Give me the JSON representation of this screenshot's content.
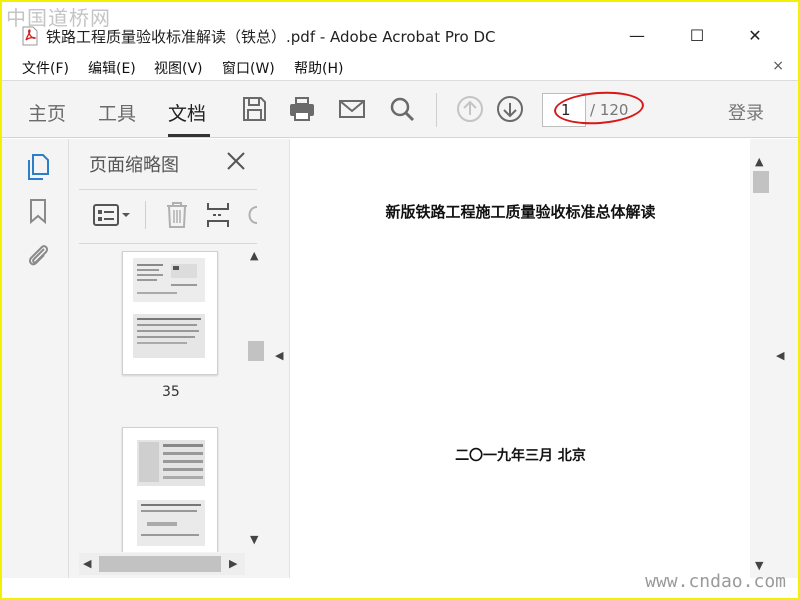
{
  "watermark": {
    "top": "中国道桥网",
    "bottom": "www.cndao.com"
  },
  "window": {
    "title": "铁路工程质量验收标准解读（铁总）.pdf - Adobe Acrobat Pro DC",
    "controls": {
      "minimize": "—",
      "maximize": "☐",
      "close": "✕"
    }
  },
  "menu": {
    "items": [
      "文件(F)",
      "编辑(E)",
      "视图(V)",
      "窗口(W)",
      "帮助(H)"
    ],
    "close": "×"
  },
  "toolbar": {
    "tabs": [
      "主页",
      "工具",
      "文档"
    ],
    "active_tab": "文档",
    "page_current": "1",
    "page_total": "/ 120",
    "login": "登录"
  },
  "panel": {
    "title": "页面缩略图",
    "thumb_label": "35"
  },
  "document": {
    "title": "新版铁路工程施工质量验收标准总体解读",
    "date": "二〇一九年三月  北京"
  },
  "colors": {
    "accent": "#2b7fc9",
    "highlight_oval": "#d71818",
    "pdf_red": "#d21f1f"
  }
}
